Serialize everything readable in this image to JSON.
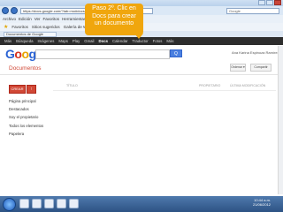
{
  "browser": {
    "address": "https://docs.google.com/?tab=mo#docs/home",
    "search_placeholder": "Google",
    "menu": [
      "Archivo",
      "Edición",
      "Ver",
      "Favoritos",
      "Herramientas",
      "Ayuda"
    ],
    "favorites": [
      "Favoritos",
      "Sitios sugeridos",
      "Galería de Web Slice"
    ],
    "tab_label": "Documentos de Google"
  },
  "google_bar": {
    "items": [
      "Más",
      "Búsqueda",
      "Imágenes",
      "Maps",
      "Play",
      "Gmail",
      "Docs",
      "Calendar",
      "Traductor",
      "Fotos",
      "Más"
    ],
    "active_index": 6
  },
  "header": {
    "logo": [
      "G",
      "o",
      "o",
      "g",
      "l",
      "e"
    ],
    "search_button": "Q",
    "user": "Ana Karina Espinoza Ramírez"
  },
  "docs": {
    "title": "Documentos",
    "sort_label": "Ordenar ▾",
    "share_label": "Compartir",
    "create_label": "CREAR",
    "upload_label": "↑",
    "sidebar": [
      "Página principal",
      "Destacados",
      "Soy el propietario",
      "Todos los elementos",
      "Papelera"
    ],
    "columns": [
      "TÍTULO",
      "PROPIETARIO",
      "ÚLTIMA MODIFICACIÓN"
    ]
  },
  "callout": {
    "line1": "Paso 2º. Clic en",
    "line2": "Docs para crear",
    "line3": "un documento",
    "color": "#f0a60d"
  },
  "taskbar": {
    "time": "10:44 a.m.",
    "date": "21/06/2012"
  },
  "colors": {
    "accent_red": "#d14836",
    "google_bar": "#2d2d2d"
  }
}
